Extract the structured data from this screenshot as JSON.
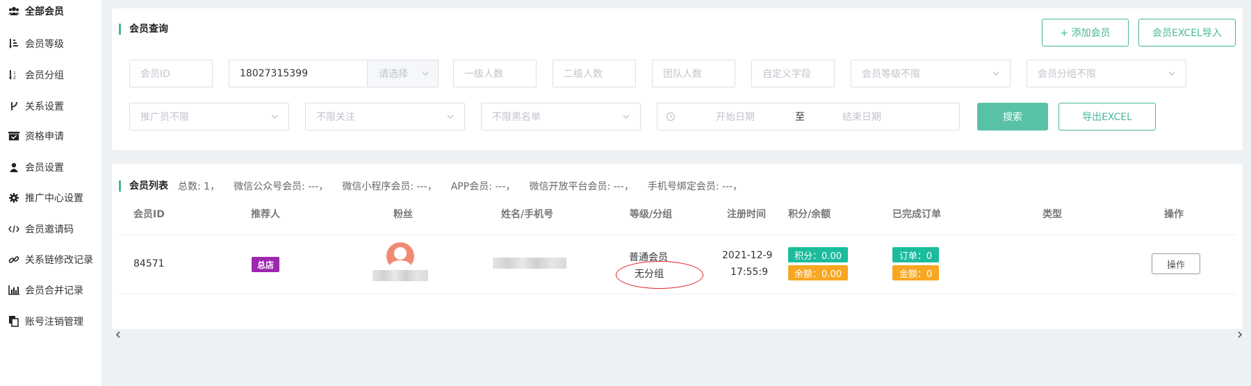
{
  "sidebar": {
    "items": [
      {
        "label": "全部会员",
        "icon": "users-icon"
      },
      {
        "label": "会员等级",
        "icon": "sort-amount-icon"
      },
      {
        "label": "会员分组",
        "icon": "sort-alpha-icon"
      },
      {
        "label": "关系设置",
        "icon": "fork-icon"
      },
      {
        "label": "资格申请",
        "icon": "inbox-check-icon"
      },
      {
        "label": "会员设置",
        "icon": "user-icon"
      },
      {
        "label": "推广中心设置",
        "icon": "gear-icon"
      },
      {
        "label": "会员邀请码",
        "icon": "code-icon"
      },
      {
        "label": "关系链修改记录",
        "icon": "link-icon"
      },
      {
        "label": "会员合并记录",
        "icon": "bar-chart-icon"
      },
      {
        "label": "账号注销管理",
        "icon": "copy-icon"
      }
    ]
  },
  "query": {
    "title": "会员查询",
    "add_member": "+ 添加会员",
    "import_excel": "会员EXCEL导入",
    "member_id_ph": "会员ID",
    "phone_value": "18027315399",
    "phone_select_ph": "请选择",
    "level1_ph": "一级人数",
    "level2_ph": "二级人数",
    "team_ph": "团队人数",
    "custom_ph": "自定义字段",
    "grade_select": "会员等级不限",
    "group_select": "会员分组不限",
    "promoter_select": "推广员不限",
    "follow_select": "不限关注",
    "blacklist_select": "不限黑名单",
    "start_date_ph": "开始日期",
    "date_sep": "至",
    "end_date_ph": "结束日期",
    "search_btn": "搜索",
    "export_btn": "导出EXCEL"
  },
  "list": {
    "title": "会员列表",
    "stats": [
      "总数:  1，",
      "微信公众号会员:  ---，",
      "微信小程序会员:  ---，",
      "APP会员:  ---，",
      "微信开放平台会员:  ---，",
      "手机号绑定会员:  ---，"
    ],
    "columns": [
      "会员ID",
      "推荐人",
      "粉丝",
      "姓名/手机号",
      "等级/分组",
      "注册时间",
      "积分/余额",
      "已完成订单",
      "类型",
      "操作"
    ],
    "row": {
      "member_id": "84571",
      "referrer_tag": "总店",
      "level": "普通会员",
      "group": "无分组",
      "reg_date": "2021-12-9",
      "reg_time": "17:55:9",
      "points": "积分：0.00",
      "balance": "余额：0.00",
      "orders": "订单：0",
      "amount": "金额：0",
      "op_btn": "操作"
    }
  },
  "colors": {
    "accent": "#44b79a",
    "teal_tag": "#1bbc9b",
    "orange_tag": "#f8a722",
    "purple_tag": "#9c27b0",
    "annotation_red": "#e02020"
  }
}
